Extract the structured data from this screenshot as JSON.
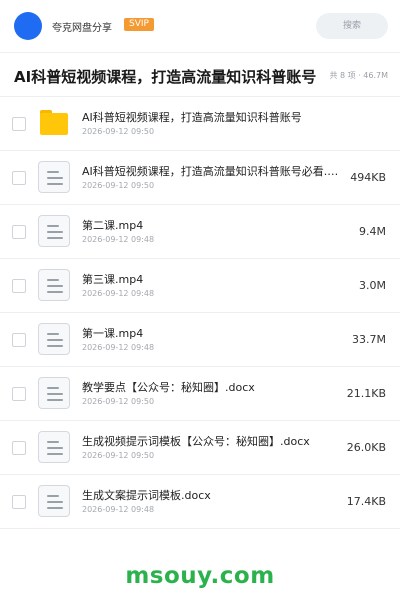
{
  "header": {
    "app_name": "夸克网盘分享",
    "badge": "SVIP",
    "search_placeholder": "搜索"
  },
  "folder": {
    "title": "AI科普短视频课程，打造高流量知识科普账号",
    "meta": "共 8 项 · 46.7M"
  },
  "files": [
    {
      "name": "AI科普短视频课程，打造高流量知识科普账号",
      "date": "2026-09-12 09:50",
      "size": "",
      "icon": "folder-icon"
    },
    {
      "name": "AI科普短视频课程，打造高流量知识科普账号必看.p…",
      "date": "2026-09-12 09:50",
      "size": "494KB",
      "icon": "document-icon"
    },
    {
      "name": "第二课.mp4",
      "date": "2026-09-12 09:48",
      "size": "9.4M",
      "icon": "document-icon"
    },
    {
      "name": "第三课.mp4",
      "date": "2026-09-12 09:48",
      "size": "3.0M",
      "icon": "document-icon"
    },
    {
      "name": "第一课.mp4",
      "date": "2026-09-12 09:48",
      "size": "33.7M",
      "icon": "document-icon"
    },
    {
      "name": "教学要点【公众号：秘知圈】.docx",
      "date": "2026-09-12 09:50",
      "size": "21.1KB",
      "icon": "document-icon"
    },
    {
      "name": "生成视频提示词模板【公众号：秘知圈】.docx",
      "date": "2026-09-12 09:50",
      "size": "26.0KB",
      "icon": "document-icon"
    },
    {
      "name": "生成文案提示词模板.docx",
      "date": "2026-09-12 09:48",
      "size": "17.4KB",
      "icon": "document-icon"
    }
  ],
  "watermark": "msouy.com",
  "colors": {
    "avatar": "#1f6cf2",
    "badge": "#f49a33",
    "folder": "#ffc60a",
    "watermark": "#2bb24c"
  }
}
